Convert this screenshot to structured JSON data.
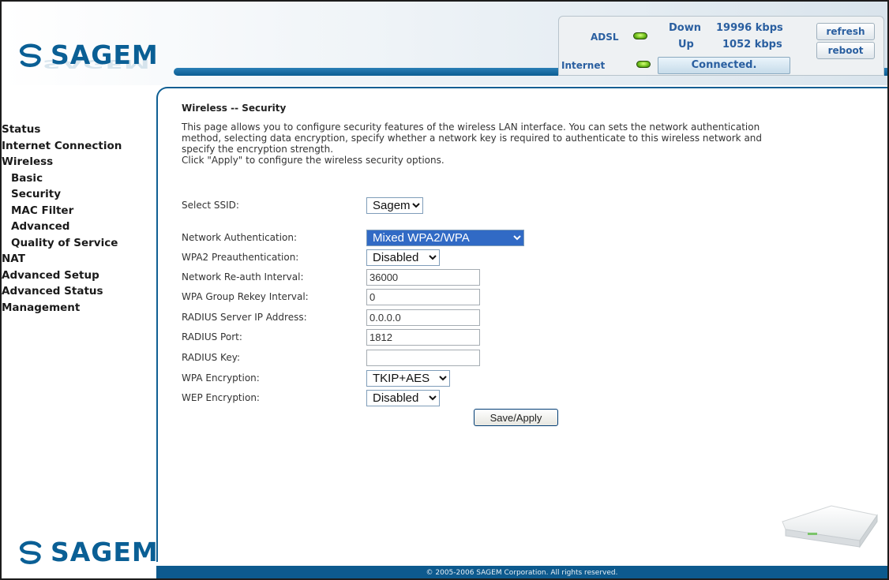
{
  "brand": {
    "name": "SAGEM"
  },
  "status": {
    "adsl_label": "ADSL",
    "internet_label": "Internet",
    "down_label": "Down",
    "down_value": "19996 kbps",
    "up_label": "Up",
    "up_value": "1052 kbps",
    "connection": "Connected.",
    "refresh_label": "refresh",
    "reboot_label": "reboot",
    "led_color": "#6fbf1c"
  },
  "sidebar": {
    "items": [
      {
        "label": "Status"
      },
      {
        "label": "Internet Connection"
      },
      {
        "label": "Wireless"
      },
      {
        "label": "Basic"
      },
      {
        "label": "Security"
      },
      {
        "label": "MAC Filter"
      },
      {
        "label": "Advanced"
      },
      {
        "label": "Quality of Service"
      },
      {
        "label": "NAT"
      },
      {
        "label": "Advanced Setup"
      },
      {
        "label": "Advanced Status"
      },
      {
        "label": "Management"
      }
    ]
  },
  "page": {
    "title": "Wireless -- Security",
    "desc1": "This page allows you to configure security features of the wireless LAN interface. You can sets the network authentication",
    "desc2": "method, selecting data encryption, specify whether a network key is required to authenticate to this wireless network and",
    "desc3": "specify the encryption strength.",
    "desc4": "Click \"Apply\" to configure the wireless security options."
  },
  "form": {
    "ssid_label": "Select SSID:",
    "ssid_value": "Sagem",
    "auth_label": "Network Authentication:",
    "auth_value": "Mixed WPA2/WPA",
    "preauth_label": "WPA2 Preauthentication:",
    "preauth_value": "Disabled",
    "reauth_label": "Network Re-auth Interval:",
    "reauth_value": "36000",
    "rekey_label": "WPA Group Rekey Interval:",
    "rekey_value": "0",
    "radius_ip_label": "RADIUS Server IP Address:",
    "radius_ip_value": "0.0.0.0",
    "radius_port_label": "RADIUS Port:",
    "radius_port_value": "1812",
    "radius_key_label": "RADIUS Key:",
    "radius_key_value": "",
    "wpa_enc_label": "WPA Encryption:",
    "wpa_enc_value": "TKIP+AES",
    "wep_enc_label": "WEP Encryption:",
    "wep_enc_value": "Disabled",
    "apply_label": "Save/Apply"
  },
  "footer": {
    "copyright": "© 2005-2006 SAGEM Corporation. All rights reserved."
  },
  "colors": {
    "brand_blue": "#0a5f95",
    "bar_blue": "#0d5a8e",
    "status_text": "#2a5fa0"
  }
}
